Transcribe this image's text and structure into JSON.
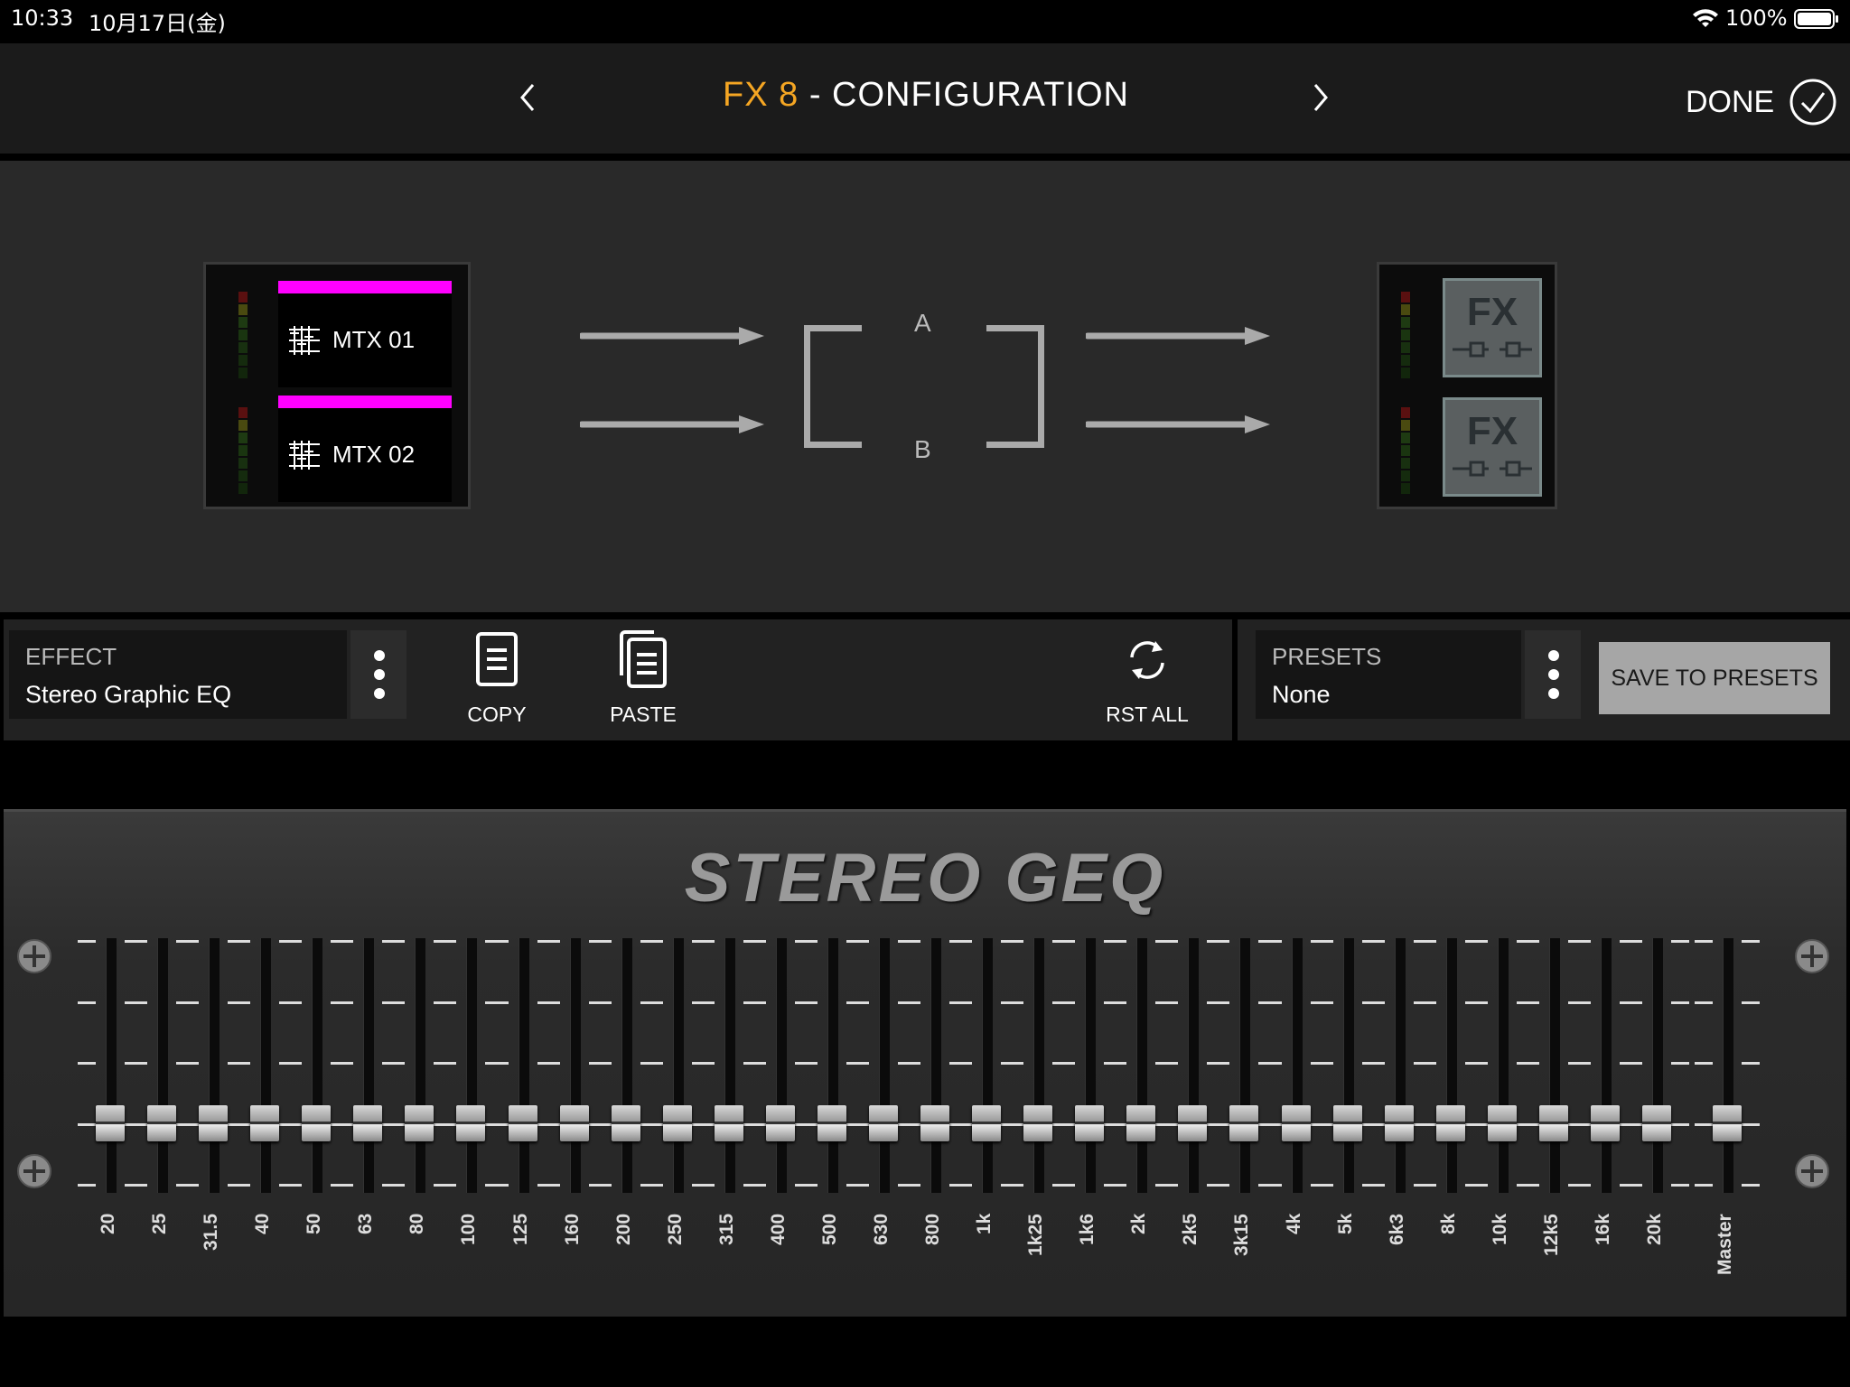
{
  "status_bar": {
    "time": "10:33",
    "date": "10月17日(金)",
    "battery": "100%"
  },
  "header": {
    "title_fx": "FX 8",
    "title_sep": "-",
    "title_cfg": "CONFIGURATION",
    "done_label": "DONE"
  },
  "routing": {
    "sources": [
      {
        "label": "MTX 01"
      },
      {
        "label": "MTX 02"
      }
    ],
    "channel_a": "A",
    "channel_b": "B",
    "destinations": [
      {
        "label": "FX"
      },
      {
        "label": "FX"
      }
    ]
  },
  "toolbar": {
    "effect_label": "EFFECT",
    "effect_value": "Stereo Graphic EQ",
    "copy_label": "COPY",
    "paste_label": "PASTE",
    "reset_label": "RST ALL",
    "presets_label": "PRESETS",
    "presets_value": "None",
    "save_label": "SAVE TO PRESETS"
  },
  "geq": {
    "title": "STEREO GEQ",
    "bands": [
      "20",
      "25",
      "31.5",
      "40",
      "50",
      "63",
      "80",
      "100",
      "125",
      "160",
      "200",
      "250",
      "315",
      "400",
      "500",
      "630",
      "800",
      "1k",
      "1k25",
      "1k6",
      "2k",
      "2k5",
      "3k15",
      "4k",
      "5k",
      "6k3",
      "8k",
      "10k",
      "12k5",
      "16k",
      "20k"
    ],
    "master_label": "Master",
    "gain_db": 0
  },
  "colors": {
    "accent": "#f5a623",
    "source_bar": "#ff00ff",
    "panel": "#292929"
  }
}
